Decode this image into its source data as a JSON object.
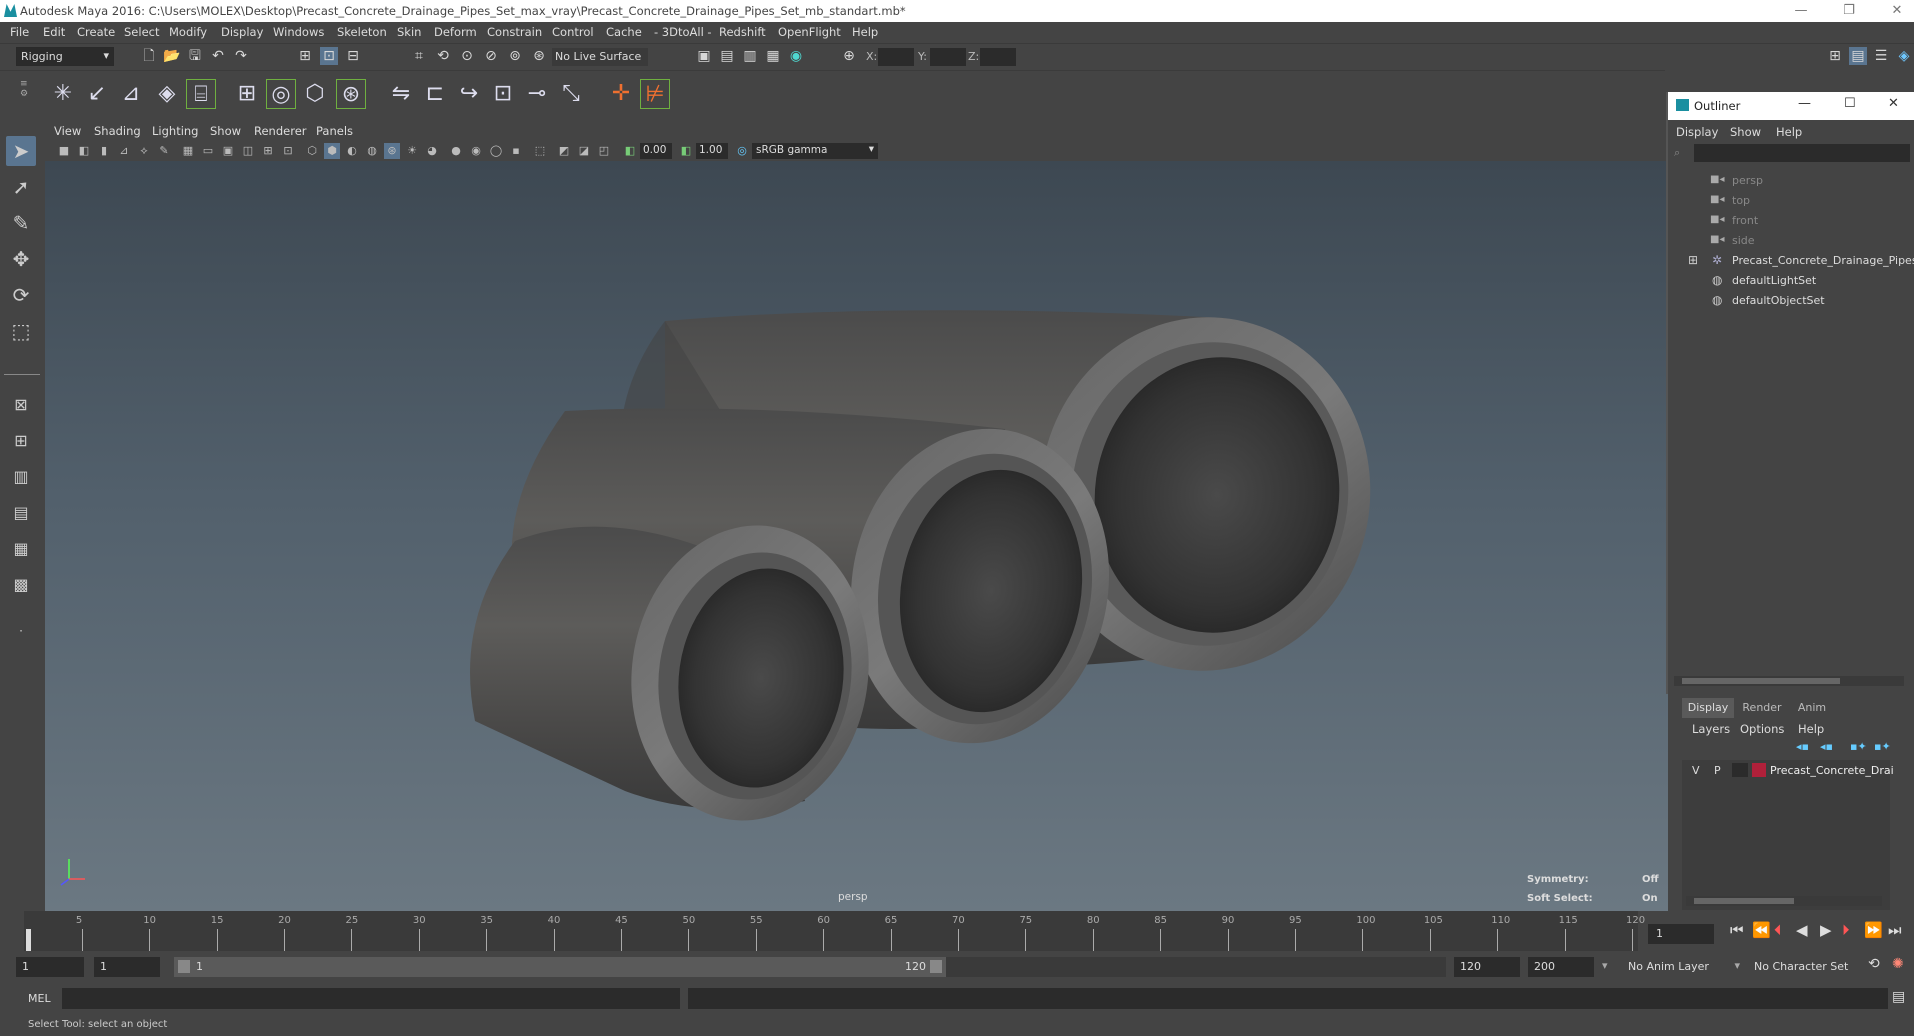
{
  "window": {
    "title": "Autodesk Maya 2016: C:\\Users\\MOLEX\\Desktop\\Precast_Concrete_Drainage_Pipes_Set_max_vray\\Precast_Concrete_Drainage_Pipes_Set_mb_standart.mb*",
    "minimize": "—",
    "restore": "❐",
    "close": "✕"
  },
  "menubar": [
    "File",
    "Edit",
    "Create",
    "Select",
    "Modify",
    "Display",
    "Windows",
    "Skeleton",
    "Skin",
    "Deform",
    "Constrain",
    "Control",
    "Cache",
    "- 3DtoAll -",
    "Redshift",
    "OpenFlight",
    "Help"
  ],
  "statusline": {
    "mode": "Rigging",
    "live_surface": "No Live Surface",
    "x_label": "X:",
    "y_label": "Y:",
    "z_label": "Z:"
  },
  "panel": {
    "menus": [
      "View",
      "Shading",
      "Lighting",
      "Show",
      "Renderer",
      "Panels"
    ],
    "exposure": "0.00",
    "gamma": "1.00",
    "colorspace": "sRGB gamma",
    "camera_label": "persp",
    "symmetry_label": "Symmetry:",
    "symmetry_value": "Off",
    "soft_select_label": "Soft Select:",
    "soft_select_value": "On"
  },
  "outliner": {
    "title": "Outliner",
    "menus": [
      "Display",
      "Show",
      "Help"
    ],
    "items": [
      {
        "label": "persp",
        "icon": "camera-icon",
        "dim": true
      },
      {
        "label": "top",
        "icon": "camera-icon",
        "dim": true
      },
      {
        "label": "front",
        "icon": "camera-icon",
        "dim": true
      },
      {
        "label": "side",
        "icon": "camera-icon",
        "dim": true
      },
      {
        "label": "Precast_Concrete_Drainage_Pipes",
        "icon": "group-icon",
        "dim": false
      },
      {
        "label": "defaultLightSet",
        "icon": "set-icon",
        "dim": false
      },
      {
        "label": "defaultObjectSet",
        "icon": "set-icon",
        "dim": false
      }
    ]
  },
  "layers": {
    "tabs": [
      "Display",
      "Render",
      "Anim"
    ],
    "menus": [
      "Layers",
      "Options",
      "Help"
    ],
    "row": {
      "v": "V",
      "p": "P",
      "name": "Precast_Concrete_Drai",
      "color": "#b0203a"
    }
  },
  "timeslider": {
    "ticks": [
      1,
      5,
      10,
      15,
      20,
      25,
      30,
      35,
      40,
      45,
      50,
      55,
      60,
      65,
      70,
      75,
      80,
      85,
      90,
      95,
      100,
      105,
      110,
      115,
      120
    ],
    "current_frame": "1"
  },
  "rangebar": {
    "start": "1",
    "start_inner": "1",
    "range_start_label": "1",
    "range_end_label": "120",
    "end": "120",
    "end_outer": "200",
    "anim_layer": "No Anim Layer",
    "character_set": "No Character Set"
  },
  "cmdline": {
    "label": "MEL"
  },
  "helpline": {
    "text": "Select Tool: select an object"
  }
}
